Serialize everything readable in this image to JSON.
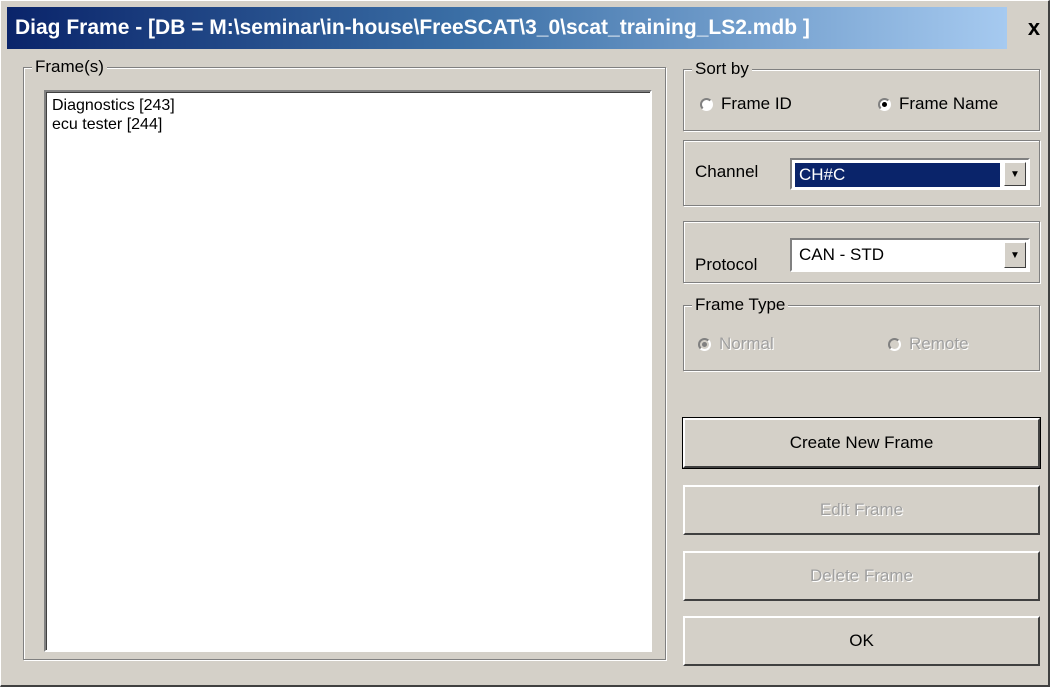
{
  "window": {
    "title": "Diag Frame - [DB = M:\\seminar\\in-house\\FreeSCAT\\3_0\\scat_training_LS2.mdb ]",
    "close_label": "x"
  },
  "frames": {
    "legend": "Frame(s)",
    "items": [
      "Diagnostics [243]",
      "ecu tester [244]"
    ]
  },
  "sort_by": {
    "legend": "Sort by",
    "options": [
      {
        "label": "Frame ID",
        "checked": false
      },
      {
        "label": "Frame Name",
        "checked": true
      }
    ]
  },
  "channel": {
    "label": "Channel",
    "value": "CH#C"
  },
  "protocol": {
    "label": "Protocol",
    "value": "CAN - STD"
  },
  "frame_type": {
    "legend": "Frame Type",
    "options": [
      {
        "label": "Normal",
        "checked": true,
        "enabled": false
      },
      {
        "label": "Remote",
        "checked": false,
        "enabled": false
      }
    ]
  },
  "buttons": {
    "create": "Create New Frame",
    "edit": "Edit Frame",
    "delete": "Delete Frame",
    "ok": "OK"
  },
  "colors": {
    "title_active": "#0a246a",
    "face": "#d4d0c8",
    "selection": "#0a246a"
  }
}
